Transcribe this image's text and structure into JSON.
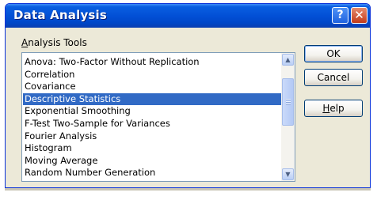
{
  "window": {
    "title": "Data Analysis",
    "help_glyph": "?",
    "close_glyph": "✕"
  },
  "group": {
    "label_prefix": "",
    "label_mnemonic": "A",
    "label_rest": "nalysis Tools"
  },
  "list": {
    "items": [
      "Anova: Two-Factor Without Replication",
      "Correlation",
      "Covariance",
      "Descriptive Statistics",
      "Exponential Smoothing",
      "F-Test Two-Sample for Variances",
      "Fourier Analysis",
      "Histogram",
      "Moving Average",
      "Random Number Generation"
    ],
    "selected": "Descriptive Statistics"
  },
  "scrollbar": {
    "up_glyph": "▲",
    "down_glyph": "▼"
  },
  "buttons": {
    "ok": "OK",
    "cancel": "Cancel",
    "help_mnemonic": "H",
    "help_rest": "elp"
  },
  "colors": {
    "titlebar": "#0250d6",
    "selection": "#316ac5",
    "dialog_bg": "#ece9d8"
  }
}
